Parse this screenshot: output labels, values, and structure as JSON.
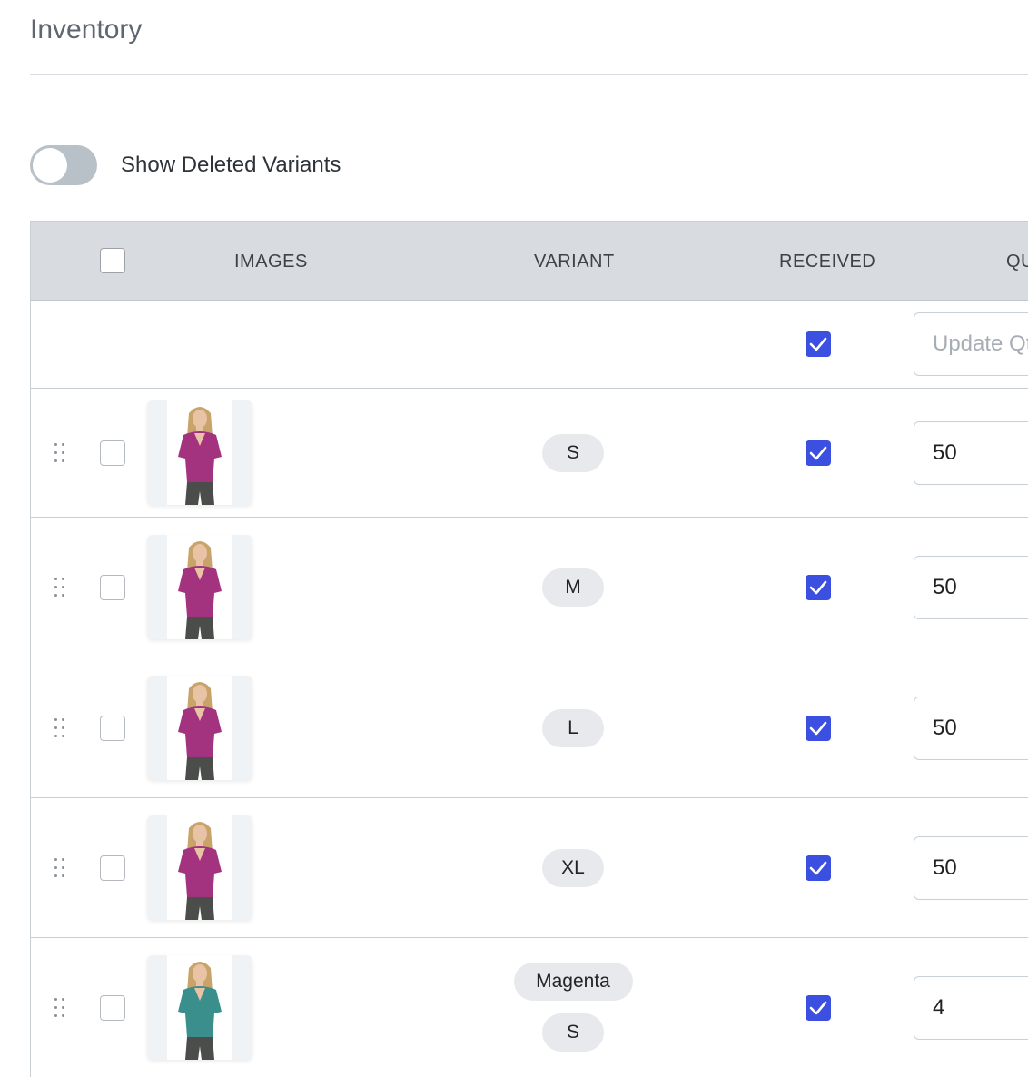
{
  "page": {
    "title": "Inventory"
  },
  "toggle": {
    "label": "Show Deleted Variants",
    "on": false
  },
  "columns": {
    "images": "IMAGES",
    "variant": "VARIANT",
    "received": "RECEIVED",
    "quantity": "QU"
  },
  "bulk_row": {
    "received": true,
    "qty_placeholder": "Update Qty"
  },
  "rows": [
    {
      "variants": [
        "S"
      ],
      "received": true,
      "qty": "50",
      "image_color": "#a3327f",
      "image_name": "magenta-tshirt-image"
    },
    {
      "variants": [
        "M"
      ],
      "received": true,
      "qty": "50",
      "image_color": "#a3327f",
      "image_name": "magenta-tshirt-image"
    },
    {
      "variants": [
        "L"
      ],
      "received": true,
      "qty": "50",
      "image_color": "#a3327f",
      "image_name": "magenta-tshirt-image"
    },
    {
      "variants": [
        "XL"
      ],
      "received": true,
      "qty": "50",
      "image_color": "#a3327f",
      "image_name": "magenta-tshirt-image"
    },
    {
      "variants": [
        "Magenta",
        "S"
      ],
      "received": true,
      "qty": "4",
      "image_color": "#3a8f8c",
      "image_name": "teal-tshirt-image"
    }
  ],
  "colors": {
    "accent": "#3b4fe0",
    "header_bg": "#d8dce0",
    "toggle_off": "#b8c0c8"
  }
}
